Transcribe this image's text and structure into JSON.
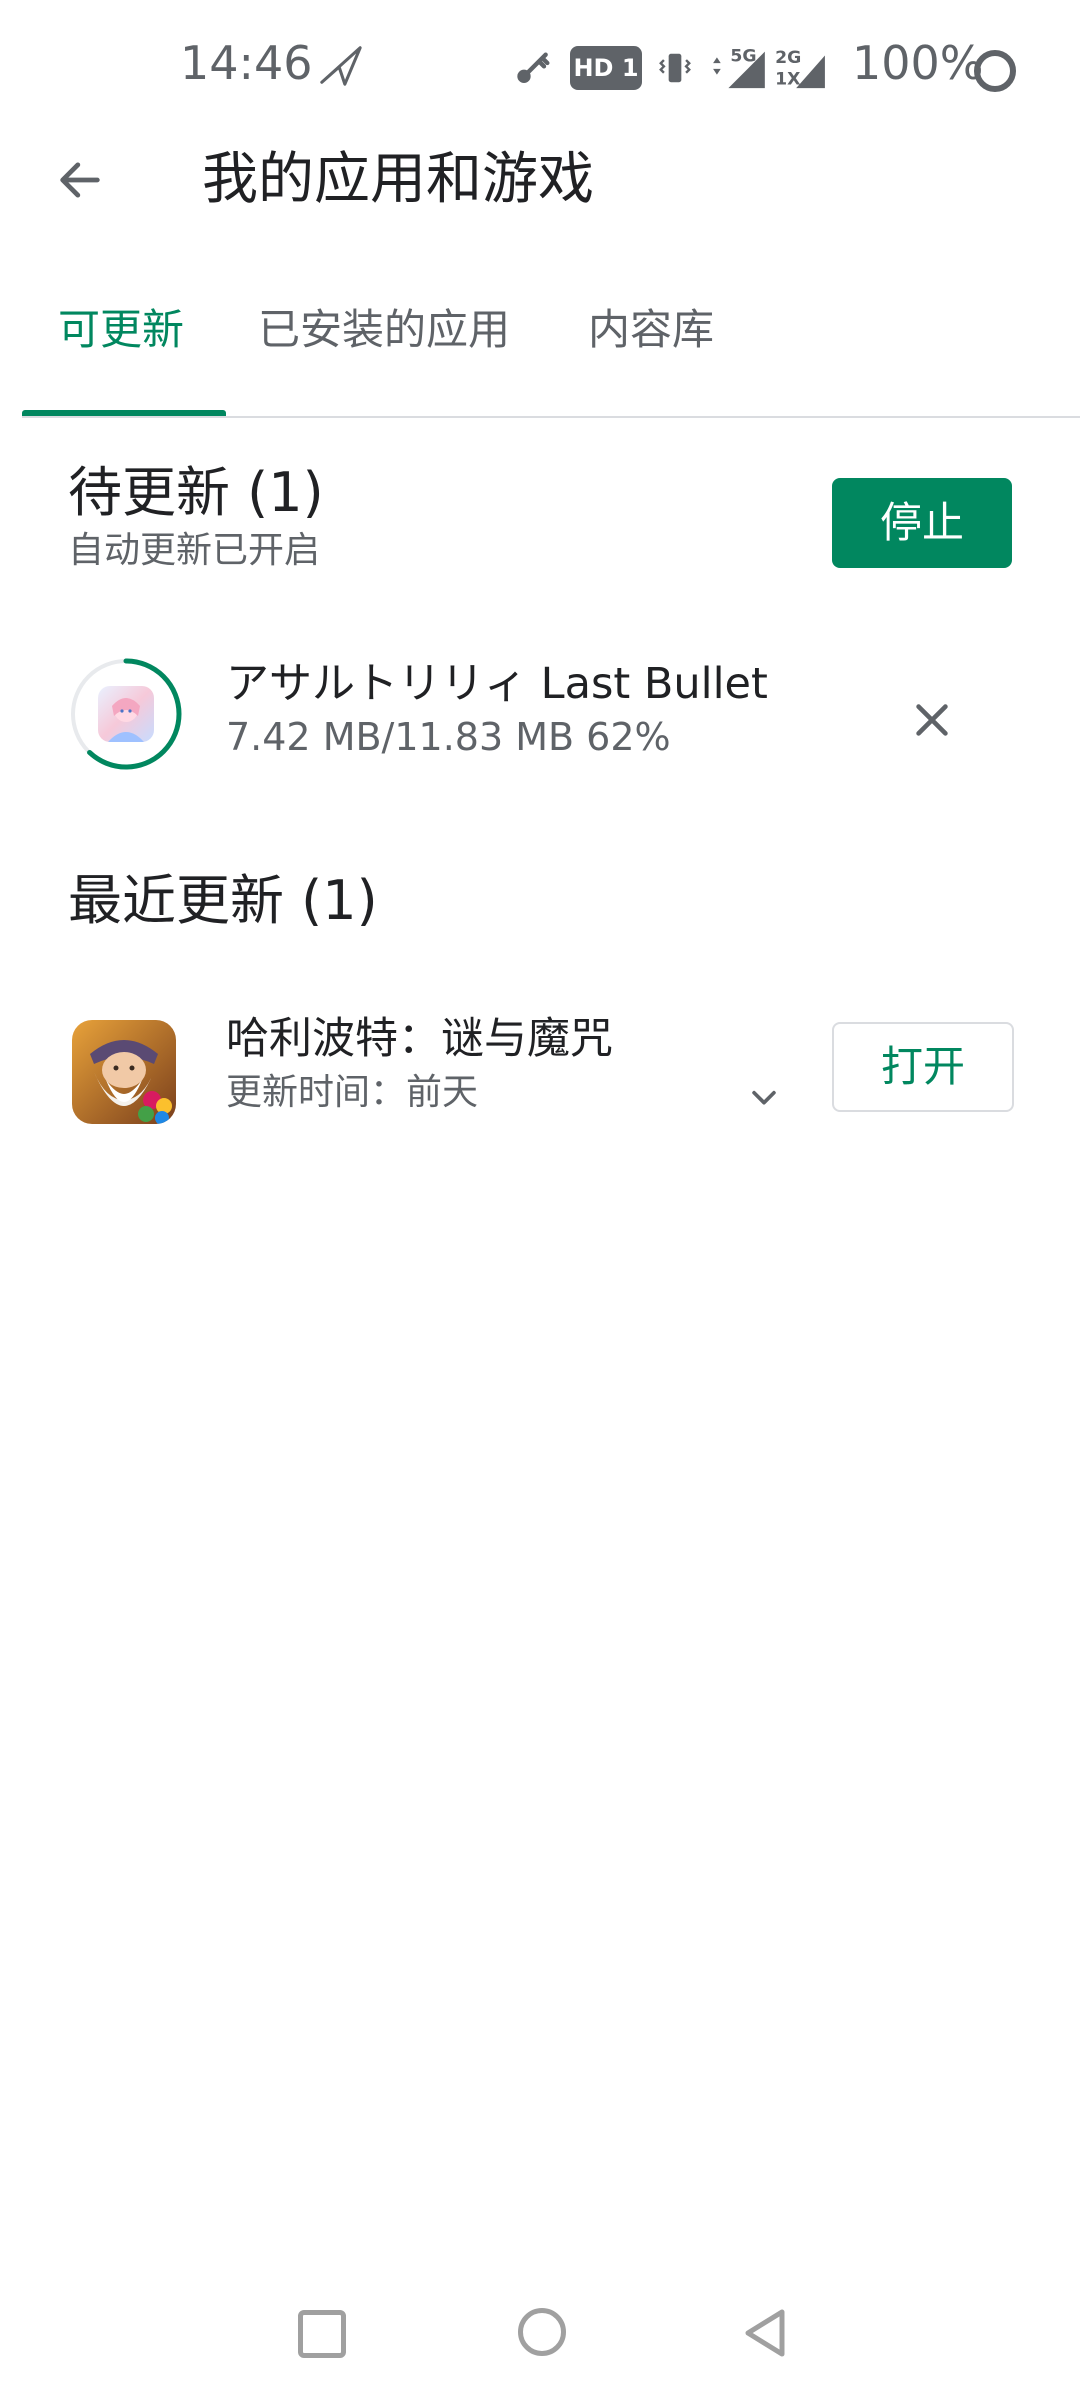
{
  "status_bar": {
    "time": "14:46",
    "hd_badge": "HD 1",
    "network_5g": "5G",
    "network_2g": "2G",
    "network_1x": "1X",
    "battery": "100%"
  },
  "app_bar": {
    "title": "我的应用和游戏",
    "back_icon": "arrow-left-icon"
  },
  "tabs": [
    {
      "label": "可更新",
      "active": true
    },
    {
      "label": "已安装的应用",
      "active": false
    },
    {
      "label": "内容库",
      "active": false
    }
  ],
  "pending": {
    "title": "待更新 (1)",
    "subtitle": "自动更新已开启",
    "stop_label": "停止",
    "item": {
      "name": "アサルトリリィ Last Bullet",
      "meta": "7.42 MB/11.83 MB  62%",
      "progress": 0.62
    }
  },
  "recent": {
    "title": "最近更新 (1)",
    "item": {
      "name": "哈利波特：谜与魔咒",
      "meta": "更新时间：前天",
      "open_label": "打开"
    }
  },
  "colors": {
    "accent": "#01875f",
    "text_primary": "#202124",
    "text_secondary": "#5f6368"
  }
}
